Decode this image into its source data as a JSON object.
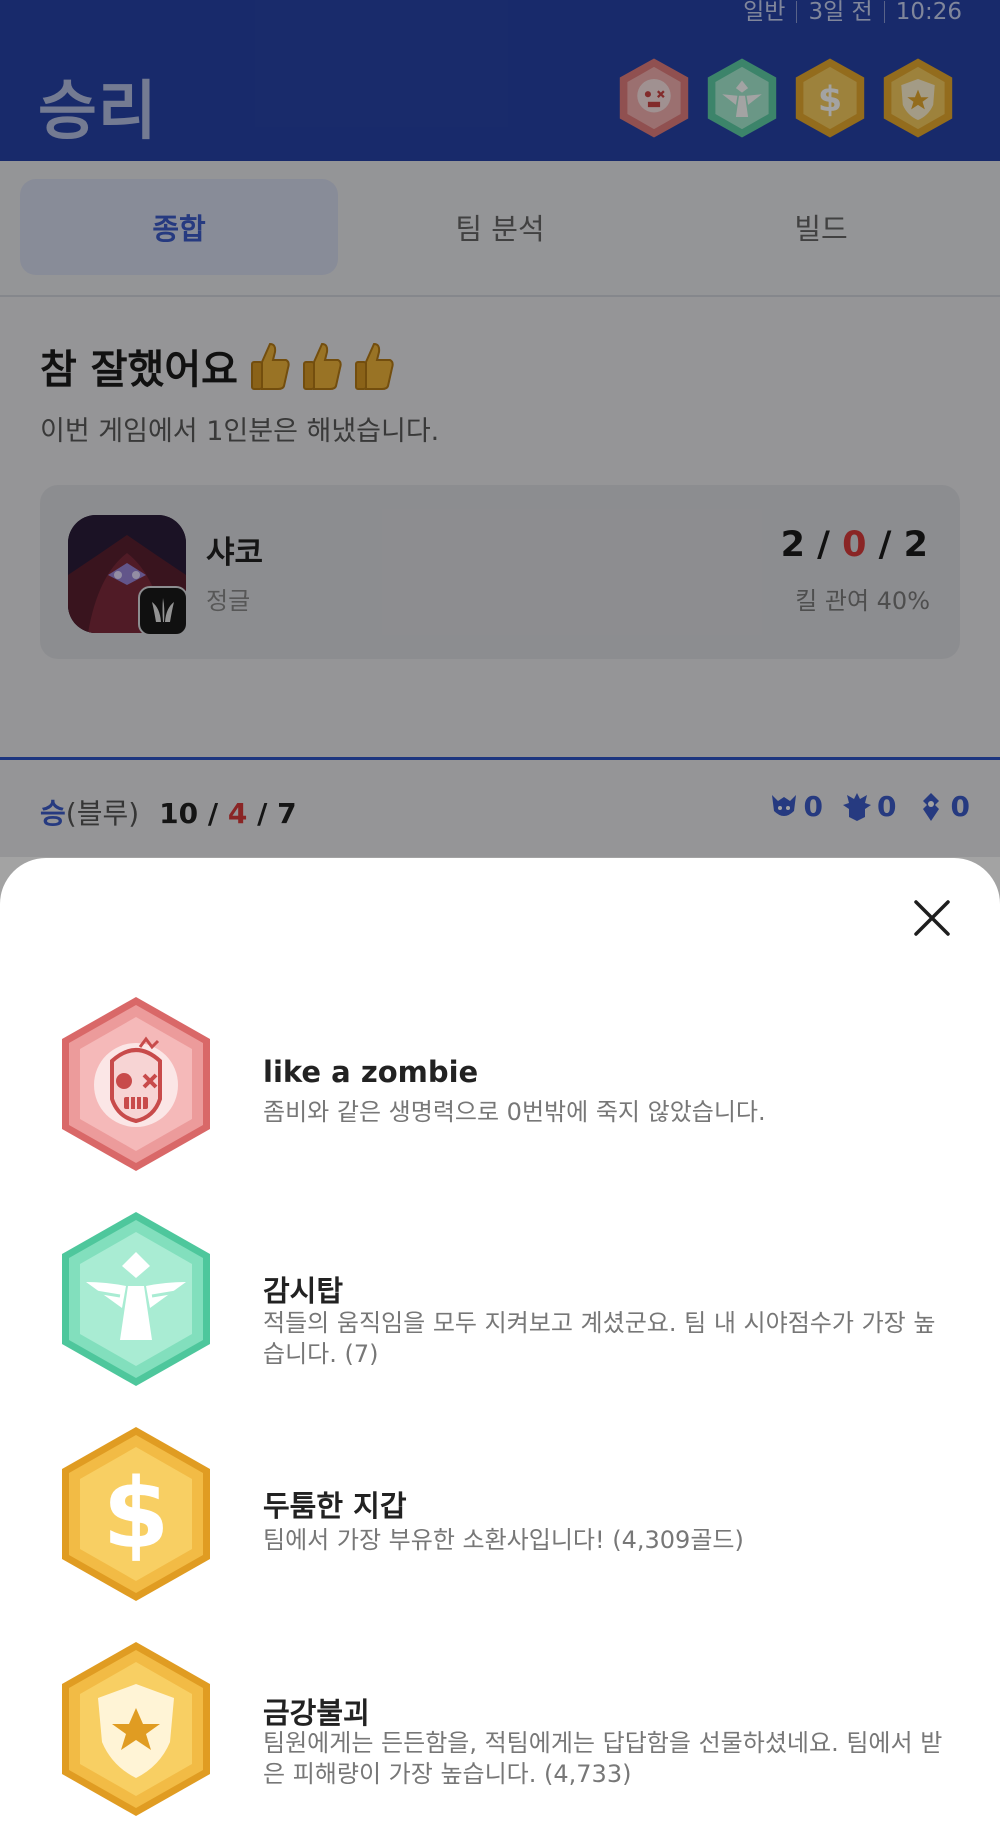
{
  "header": {
    "title": "승리",
    "meta": {
      "queue": "일반",
      "ago": "3일 전",
      "time": "10:26"
    },
    "badge_icons": [
      "zombie-badge-icon",
      "ward-badge-icon",
      "gold-badge-icon",
      "shield-badge-icon"
    ]
  },
  "tabs": [
    {
      "label": "종합",
      "active": true
    },
    {
      "label": "팀 분석",
      "active": false
    },
    {
      "label": "빌드",
      "active": false
    }
  ],
  "summary": {
    "title": "참 잘했어요",
    "subtitle": "이번 게임에서 1인분은 해냈습니다.",
    "player": {
      "champion": "샤코",
      "role": "정글",
      "kills": "2",
      "deaths": "0",
      "assists": "2",
      "kill_participation": "킬 관여 40%"
    }
  },
  "team": {
    "result": "승",
    "side": "(블루)",
    "kills": "10",
    "deaths": "4",
    "assists": "7",
    "objectives": [
      {
        "icon": "baron-icon",
        "count": "0"
      },
      {
        "icon": "dragon-icon",
        "count": "0"
      },
      {
        "icon": "tower-icon",
        "count": "0"
      }
    ]
  },
  "sheet": {
    "badges": [
      {
        "icon": "zombie-badge-icon",
        "name": "like a zombie",
        "description": "좀비와 같은 생명력으로 0번밖에 죽지 않았습니다."
      },
      {
        "icon": "ward-badge-icon",
        "name": "감시탑",
        "description": "적들의 움직임을 모두 지켜보고 계셨군요. 팀 내 시야점수가 가장 높습니다. (7)"
      },
      {
        "icon": "gold-badge-icon",
        "name": "두툼한 지갑",
        "description": "팀에서 가장 부유한 소환사입니다! (4,309골드)"
      },
      {
        "icon": "shield-badge-icon",
        "name": "금강불괴",
        "description": "팀원에게는 든든함을, 적팀에게는 답답함을 선물하셨네요. 팀에서 받은 피해량이 가장 높습니다. (4,733)"
      }
    ]
  },
  "colors": {
    "header_bg": "#2743a8",
    "accent_blue": "#3c5cc9",
    "death_red": "#d83a3a",
    "zombie_badge": "#e58585",
    "ward_badge": "#6fd9b4",
    "gold_badge": "#f0b842"
  }
}
